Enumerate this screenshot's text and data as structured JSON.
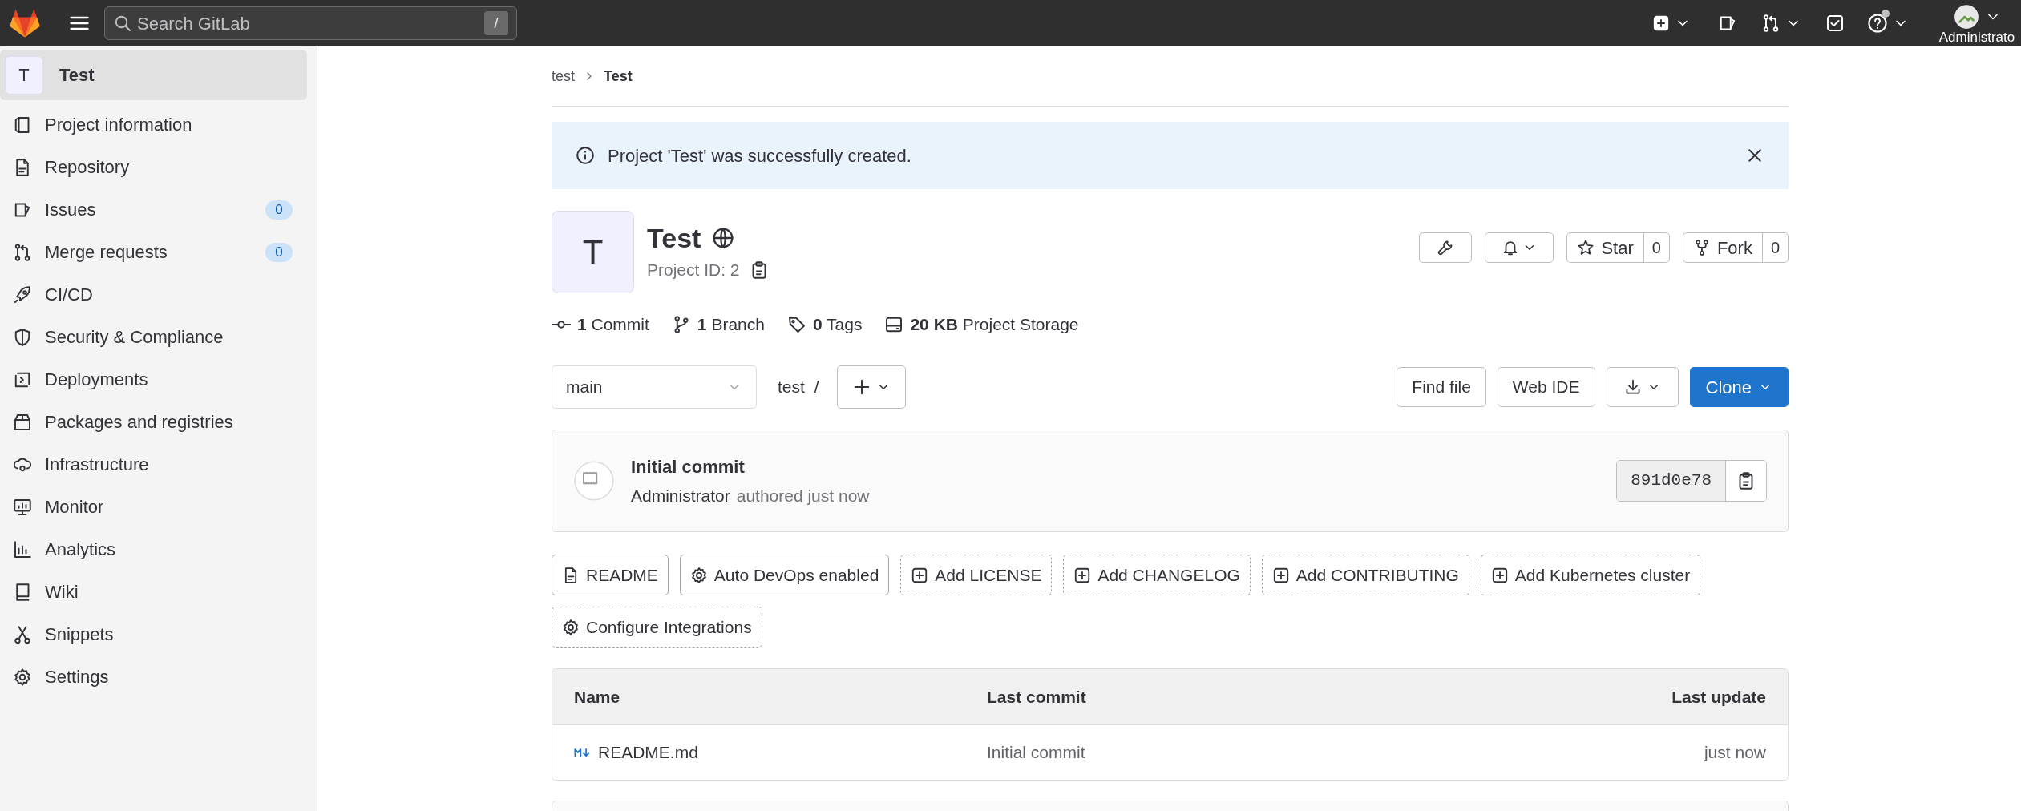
{
  "top_bar": {
    "search": {
      "placeholder": "Search GitLab"
    },
    "search_shortcut": "/",
    "user_name": "Administrato"
  },
  "sidebar": {
    "project": {
      "avatar_letter": "T",
      "name": "Test",
      "selected": true
    },
    "items": [
      {
        "label": "Project information"
      },
      {
        "label": "Repository"
      },
      {
        "label": "Issues",
        "badge": "0"
      },
      {
        "label": "Merge requests",
        "badge": "0"
      },
      {
        "label": "CI/CD"
      },
      {
        "label": "Security & Compliance"
      },
      {
        "label": "Deployments"
      },
      {
        "label": "Packages and registries"
      },
      {
        "label": "Infrastructure"
      },
      {
        "label": "Monitor"
      },
      {
        "label": "Analytics"
      },
      {
        "label": "Wiki"
      },
      {
        "label": "Snippets"
      },
      {
        "label": "Settings"
      }
    ]
  },
  "breadcrumb": [
    "test",
    "Test"
  ],
  "alert": {
    "message": "Project 'Test' was successfully created."
  },
  "project": {
    "avatar_letter": "T",
    "name": "Test",
    "project_id": "Project ID: 2",
    "star_label": "Star",
    "star_count": "0",
    "fork_label": "Fork",
    "fork_count": "0"
  },
  "stats": [
    {
      "value": "1",
      "label": "Commit"
    },
    {
      "value": "1",
      "label": "Branch"
    },
    {
      "value": "0",
      "label": "Tags"
    },
    {
      "value": "20 KB",
      "label": "Project Storage"
    }
  ],
  "branch": {
    "value": "main"
  },
  "path": "test",
  "path_separator": "/",
  "actions": {
    "find_file": "Find file",
    "web_ide": "Web IDE",
    "clone": "Clone"
  },
  "last_commit": {
    "title": "Initial commit",
    "author": "Administrator",
    "meta": "authored just now",
    "sha": "891d0e78"
  },
  "quick_actions": [
    {
      "label": "README",
      "kind": "file"
    },
    {
      "label": "Auto DevOps enabled",
      "kind": "setting"
    },
    {
      "label": "Add LICENSE",
      "kind": "add"
    },
    {
      "label": "Add CHANGELOG",
      "kind": "add"
    },
    {
      "label": "Add CONTRIBUTING",
      "kind": "add"
    },
    {
      "label": "Add Kubernetes cluster",
      "kind": "add"
    },
    {
      "label": "Configure Integrations",
      "kind": "integration"
    }
  ],
  "file_table": {
    "columns": [
      "Name",
      "Last commit",
      "Last update"
    ],
    "rows": [
      {
        "name": "README.md",
        "last_commit": "Initial commit",
        "last_update": "just now"
      }
    ]
  }
}
